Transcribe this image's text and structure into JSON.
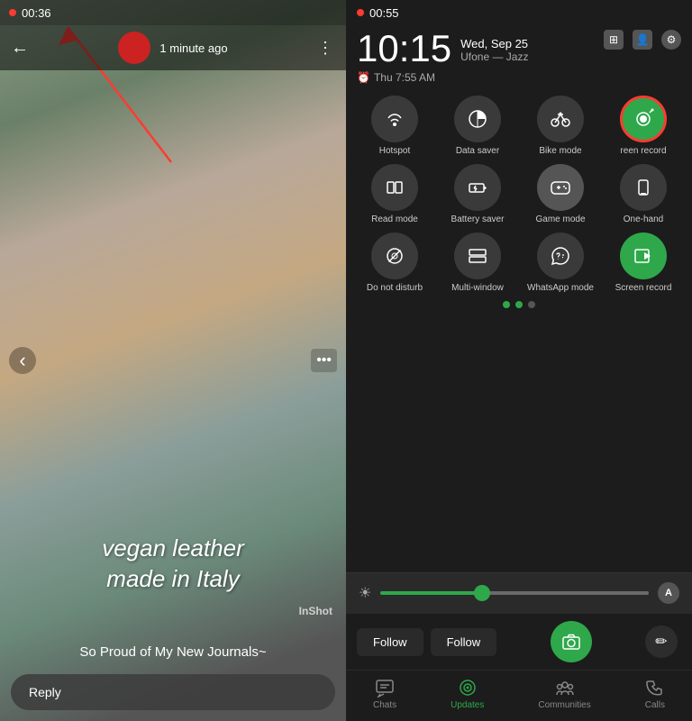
{
  "left": {
    "status_time": "00:36",
    "story_time_ago": "1 minute ago",
    "story_title_line1": "vegan leather",
    "story_title_line2": "made in Italy",
    "watermark": "InShot",
    "caption": "So Proud of My New Journals~",
    "reply_label": "Reply"
  },
  "right": {
    "status_time": "00:55",
    "big_time": "10:15",
    "date": "Wed, Sep 25",
    "carrier": "Ufone — Jazz",
    "alarm": "Thu 7:55 AM",
    "quick_settings": [
      {
        "id": "hotspot",
        "label": "Hotspot",
        "active": false,
        "highlighted": false
      },
      {
        "id": "data_saver",
        "label": "Data saver",
        "active": false,
        "highlighted": false
      },
      {
        "id": "bike_mode",
        "label": "Bike mode",
        "active": false,
        "highlighted": false
      },
      {
        "id": "screen_record",
        "label": "reen record",
        "active": true,
        "highlighted": true
      },
      {
        "id": "read_mode",
        "label": "Read mode",
        "active": false,
        "highlighted": false
      },
      {
        "id": "battery_saver",
        "label": "Battery saver",
        "active": false,
        "highlighted": false
      },
      {
        "id": "game_mode",
        "label": "Game mode",
        "active": false,
        "highlighted": false
      },
      {
        "id": "one_hand",
        "label": "One-hand",
        "active": false,
        "highlighted": false
      },
      {
        "id": "do_not_disturb",
        "label": "Do not disturb",
        "active": false,
        "highlighted": false
      },
      {
        "id": "multi_window",
        "label": "Multi-window",
        "active": false,
        "highlighted": false
      },
      {
        "id": "whatsapp_mode",
        "label": "WhatsApp mode",
        "active": false,
        "highlighted": false
      },
      {
        "id": "screen_record2",
        "label": "Screen record",
        "active": true,
        "highlighted": false
      }
    ],
    "follow_label": "Follow",
    "wa_nav": [
      {
        "id": "chats",
        "label": "Chats",
        "active": false
      },
      {
        "id": "updates",
        "label": "Updates",
        "active": true
      },
      {
        "id": "communities",
        "label": "Communities",
        "active": false
      },
      {
        "id": "calls",
        "label": "Calls",
        "active": false
      }
    ]
  },
  "icons": {
    "hotspot": "📶",
    "data_saver": "◑",
    "bike_mode": "🏍",
    "screen_record": "⏺",
    "read_mode": "📖",
    "battery_saver": "🔋",
    "game_mode": "🎮",
    "one_hand": "📱",
    "do_not_disturb": "🚫",
    "multi_window": "▬",
    "whatsapp_mode": "💬",
    "screen_record2": "⏺",
    "alarm": "⏰",
    "back": "←",
    "three_dots": "⋮",
    "brightness_low": "☀",
    "auto": "A",
    "chats": "💬",
    "updates": "⊙",
    "communities": "👥",
    "calls": "📞",
    "pencil": "✏",
    "camera": "📷"
  },
  "colors": {
    "green": "#2ea84a",
    "red": "#ff3b30",
    "dark_bg": "#1c1c1c",
    "circle_bg": "#3a3a3a",
    "highlighted_border": "#ff3b30"
  }
}
